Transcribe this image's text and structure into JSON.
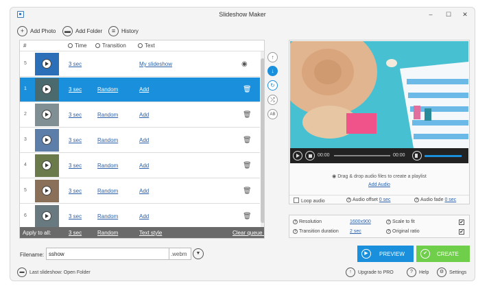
{
  "window": {
    "title": "Slideshow Maker",
    "minimize": "–",
    "maximize": "☐",
    "close": "✕"
  },
  "toolbar": {
    "add_photo": "Add Photo",
    "add_folder": "Add Folder",
    "history": "History"
  },
  "grid": {
    "headers": {
      "num": "#",
      "time": "Time",
      "transition": "Transition",
      "text": "Text"
    },
    "rows": [
      {
        "num": "5",
        "time": "3 sec",
        "transition": "",
        "text": "My slideshow",
        "action_icon": "eye-icon",
        "selected": false
      },
      {
        "num": "1",
        "time": "3 sec",
        "transition": "Random",
        "text": "Add",
        "action_icon": "trash-icon",
        "selected": true
      },
      {
        "num": "2",
        "time": "3 sec",
        "transition": "Random",
        "text": "Add",
        "action_icon": "trash-icon",
        "selected": false
      },
      {
        "num": "3",
        "time": "3 sec",
        "transition": "Random",
        "text": "Add",
        "action_icon": "trash-icon",
        "selected": false
      },
      {
        "num": "4",
        "time": "3 sec",
        "transition": "Random",
        "text": "Add",
        "action_icon": "trash-icon",
        "selected": false
      },
      {
        "num": "5",
        "time": "3 sec",
        "transition": "Random",
        "text": "Add",
        "action_icon": "trash-icon",
        "selected": false
      },
      {
        "num": "6",
        "time": "3 sec",
        "transition": "Random",
        "text": "Add",
        "action_icon": "trash-icon",
        "selected": false
      }
    ],
    "apply_bar": {
      "label": "Apply to all:",
      "time": "3 sec",
      "transition": "Random",
      "text_style": "Text style",
      "clear_queue": "Clear queue (8)"
    }
  },
  "side_buttons": [
    "move-up-icon",
    "move-down-icon",
    "rotate-icon",
    "shuffle-icon",
    "ab-text-icon"
  ],
  "player": {
    "time_start": "00:00",
    "time_end": "00:00"
  },
  "audio": {
    "drop_hint": "Drag & drop audio files to create a playlist",
    "add_audio": "Add Audio",
    "loop_audio": "Loop audio",
    "audio_offset_label": "Audio offset",
    "audio_offset_value": "0 sec",
    "audio_fade_label": "Audio fade",
    "audio_fade_value": "0 sec"
  },
  "settings": {
    "resolution_label": "Resolution",
    "resolution_value": "1600x900",
    "scale_label": "Scale to fit",
    "transition_label": "Transition duration",
    "transition_value": "2 sec",
    "ratio_label": "Original ratio",
    "scale_checked": "✔",
    "ratio_checked": "✔"
  },
  "filename": {
    "label": "Filename:",
    "value": "sshow",
    "extension": ".webm"
  },
  "buttons": {
    "preview": "PREVIEW",
    "create": "CREATE"
  },
  "bottom": {
    "last_slideshow": "Last slideshow: Open Folder",
    "upgrade": "Upgrade to PRO",
    "help": "Help",
    "settings": "Settings"
  },
  "colors": {
    "accent": "#1a8fdb",
    "create": "#6fcf4a",
    "link": "#2a5fa8"
  }
}
